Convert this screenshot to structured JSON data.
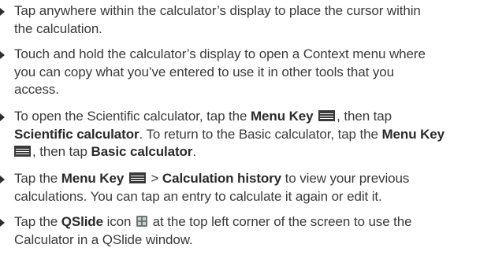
{
  "items": [
    {
      "lines": [
        "Tap anywhere within the calculator’s display to place the cursor within",
        "the calculation."
      ]
    },
    {
      "lines": [
        "Touch and hold the calculator’s display to open a Context menu where",
        "you can copy what you’ve entered to use it in other tools that you",
        "access."
      ]
    },
    {
      "l1_a": "To open the Scientific calculator, tap the ",
      "l1_b": "Menu Key",
      "l1_c": ", then tap",
      "l2_a": "Scientific calculator",
      "l2_b": ". To return to the Basic calculator, tap the ",
      "l2_c": "Menu Key",
      "l3_a": ", then tap ",
      "l3_b": "Basic calculator",
      "l3_c": "."
    },
    {
      "l1_a": "Tap the ",
      "l1_b": "Menu Key",
      "l1_c": " > ",
      "l1_d": "Calculation history",
      "l1_e": " to view your previous",
      "l2": "calculations. You can tap an entry to calculate it again or edit it."
    },
    {
      "l1_a": "Tap the ",
      "l1_b": "QSlide",
      "l1_c": " icon ",
      "l1_d": " at the top left corner of the screen to use the",
      "l2": "Calculator in a QSlide window."
    }
  ],
  "icons": {
    "menu_key": "menu-key-icon",
    "qslide": "qslide-icon",
    "bullet": "triangle-bullet"
  }
}
